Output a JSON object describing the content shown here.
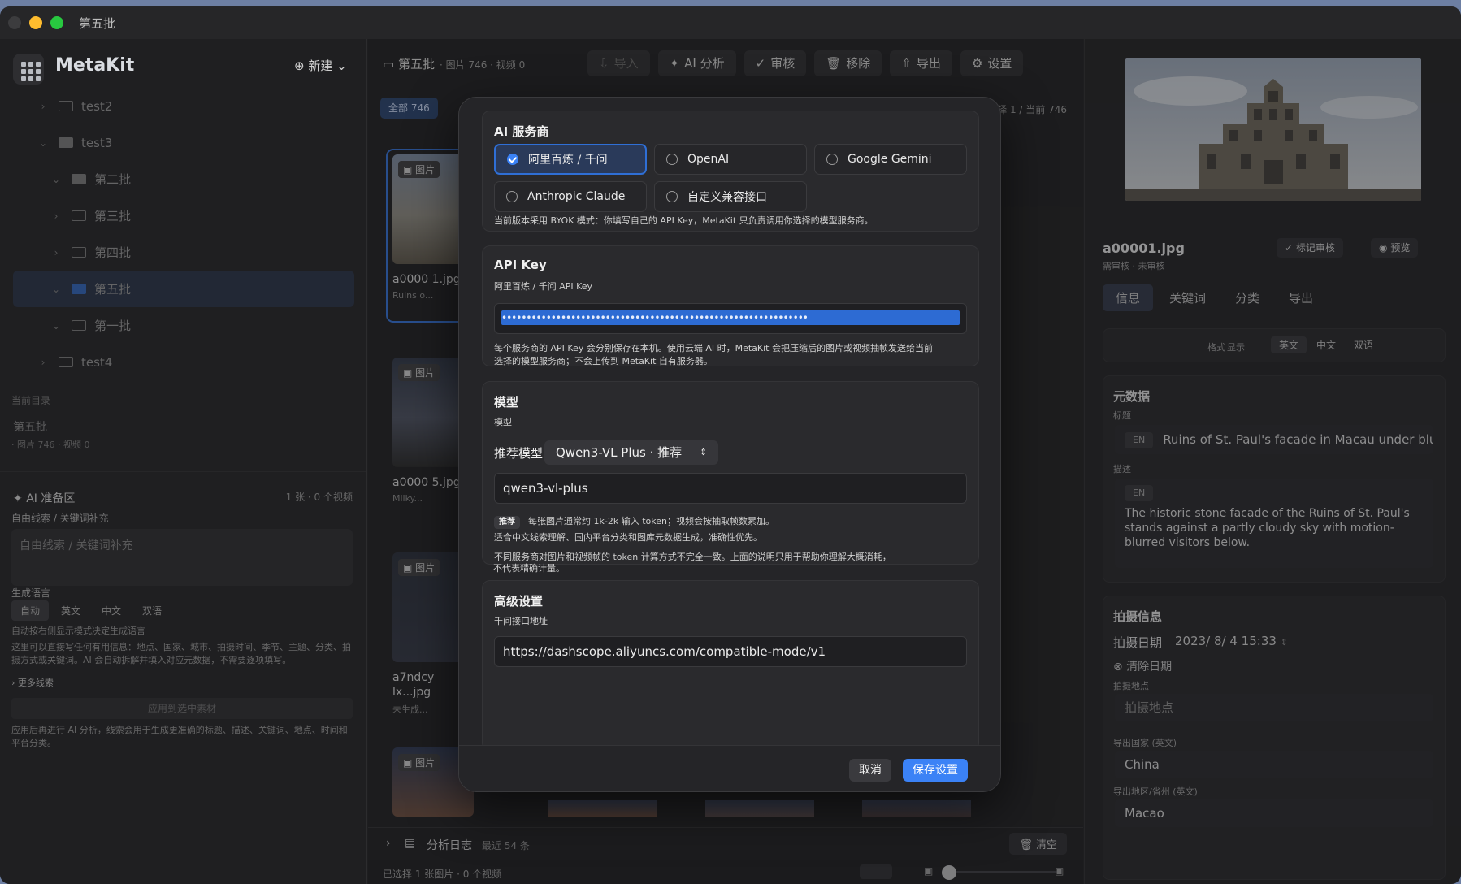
{
  "window": {
    "title": "第五批"
  },
  "sidebar": {
    "app_name": "MetaKit",
    "new_button": "⊕ 新建 ⌄",
    "tree": [
      {
        "label": "test2",
        "level": 1,
        "expanded": false
      },
      {
        "label": "test3",
        "level": 1,
        "expanded": true
      },
      {
        "label": "第二批",
        "level": 2,
        "expanded": true
      },
      {
        "label": "第三批",
        "level": 2,
        "expanded": false
      },
      {
        "label": "第四批",
        "level": 2,
        "expanded": false
      },
      {
        "label": "第五批",
        "level": 2,
        "expanded": true,
        "selected": true
      },
      {
        "label": "第一批",
        "level": 2,
        "expanded": true
      },
      {
        "label": "test4",
        "level": 1,
        "expanded": false
      }
    ],
    "current_dir_label": "当前目录",
    "current_dir_name": "第五批",
    "current_dir_stats": "· 图片 746 · 视频 0",
    "ai_zone": {
      "title": "AI 准备区",
      "count": "1 张 · 0 个视频",
      "clue_label": "自由线索 / 关键词补充",
      "clue_placeholder": "自由线索 / 关键词补充",
      "lang_label": "生成语言",
      "langs": [
        "自动",
        "英文",
        "中文",
        "双语"
      ],
      "lang_hint": "自动按右侧显示模式决定生成语言",
      "help": "这里可以直接写任何有用信息：地点、国家、城市、拍摄时间、季节、主题、分类、拍摄方式或关键词。AI 会自动拆解并填入对应元数据，不需要逐项填写。",
      "more": "更多线索",
      "apply": "应用到选中素材",
      "footnote": "应用后再进行 AI 分析，线索会用于生成更准确的标题、描述、关键词、地点、时间和平台分类。"
    }
  },
  "center": {
    "folder": "第五批",
    "stats": "· 图片 746 · 视频 0",
    "toolbar": [
      "导入",
      "AI 分析",
      "审核",
      "移除",
      "导出",
      "设置"
    ],
    "filter_all": "全部 746",
    "selection_info": "选择 1 / 当前 746",
    "cards": [
      {
        "badge": "图片",
        "name": "a0000 1.jpg",
        "sub": "Ruins o..."
      },
      {
        "badge": "图片",
        "name": "a0000 5.jpg",
        "sub": "Milky..."
      },
      {
        "badge": "图片",
        "name": "a7ndcy lx...jpg",
        "sub": "未生成..."
      },
      {
        "badge": "图片",
        "name": "",
        "sub": ""
      }
    ],
    "log_label": "分析日志",
    "log_count": "最近 54 条",
    "clear": "清空",
    "status": "已选择 1 张图片 · 0 个视频"
  },
  "right": {
    "filename": "a00001.jpg",
    "file_status": "需审核 · 未审核",
    "mark_review": "标记审核",
    "preview": "预览",
    "tabs": [
      "信息",
      "关键词",
      "分类",
      "导出"
    ],
    "format_label": "格式",
    "display_label": "显示",
    "display_langs": [
      "英文",
      "中文",
      "双语"
    ],
    "metadata_title": "元数据",
    "title_label": "标题",
    "title_lang": "EN",
    "title_value": "Ruins of St. Paul's facade in Macau under blue",
    "desc_label": "描述",
    "desc_lang": "EN",
    "desc_value": "The historic stone facade of the Ruins of St. Paul's stands against a partly cloudy sky with motion-blurred visitors below.",
    "shoot_title": "拍摄信息",
    "shoot_date_label": "拍摄日期",
    "shoot_date": "2023/ 8/ 4 15:33",
    "clear_date": "清除日期",
    "location_label": "拍摄地点",
    "location_placeholder": "拍摄地点",
    "country_label": "导出国家 (英文)",
    "country": "China",
    "region_label": "导出地区/省州 (英文)",
    "region": "Macao"
  },
  "modal": {
    "provider": {
      "title": "AI 服务商",
      "options": [
        "阿里百炼 / 千问",
        "OpenAI",
        "Google Gemini",
        "Anthropic Claude",
        "自定义兼容接口"
      ],
      "selected": "阿里百炼 / 千问",
      "note": "当前版本采用 BYOK 模式：你填写自己的 API Key，MetaKit 只负责调用你选择的模型服务商。"
    },
    "apikey": {
      "title": "API Key",
      "label": "阿里百炼 / 千问 API Key",
      "masked": "••••••••••••••••••••••••••••••••••••••••••••••••••••••••••••••",
      "note1": "每个服务商的 API Key 会分别保存在本机。使用云端 AI 时，MetaKit 会把压缩后的图片或视频抽帧发送给当前",
      "note2": "选择的模型服务商；不会上传到 MetaKit 自有服务器。"
    },
    "model": {
      "title": "模型",
      "label": "模型",
      "recommend_label": "推荐模型",
      "recommend_value": "Qwen3-VL Plus · 推荐",
      "model_value": "qwen3-vl-plus",
      "tag": "推荐",
      "tip1": "每张图片通常约 1k-2k 输入 token；视频会按抽取帧数累加。",
      "tip2": "适合中文线索理解、国内平台分类和图库元数据生成，准确性优先。",
      "tip3": "不同服务商对图片和视频帧的 token 计算方式不完全一致。上面的说明只用于帮助你理解大概消耗，",
      "tip4": "不代表精确计量。"
    },
    "advanced": {
      "title": "高级设置",
      "endpoint_label": "千问接口地址",
      "endpoint": "https://dashscope.aliyuncs.com/compatible-mode/v1"
    },
    "cancel": "取消",
    "save": "保存设置"
  }
}
